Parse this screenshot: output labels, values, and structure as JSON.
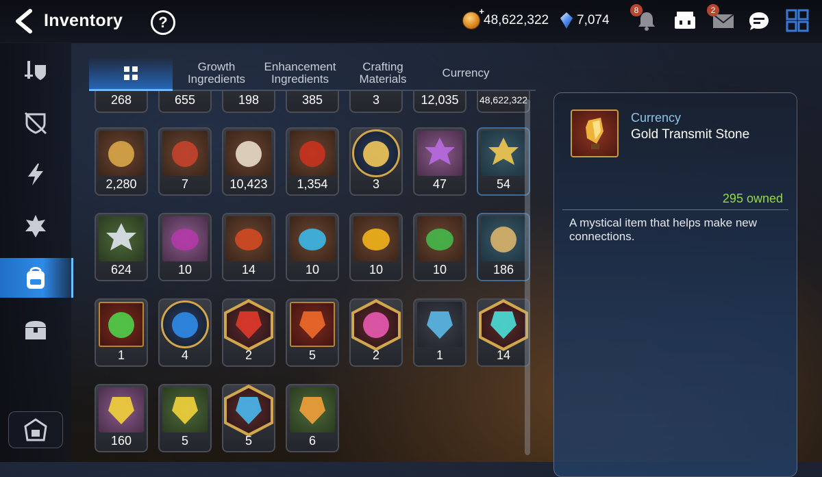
{
  "header": {
    "title": "Inventory",
    "help_label": "?",
    "gold": "48,622,322",
    "crystals": "7,074",
    "notifications_badge": "8",
    "mail_badge": "2"
  },
  "icons": {
    "back": "chevron-left-icon",
    "help": "question-circle-icon",
    "gold": "gold-coin-icon",
    "crystal": "crystal-gem-icon",
    "bell": "bell-icon",
    "shop": "shop-icon",
    "mail": "mail-icon",
    "chat": "chat-icon",
    "menu": "grid-menu-icon"
  },
  "sidebar": {
    "items": [
      {
        "name": "equipment-icon"
      },
      {
        "name": "artifact-icon"
      },
      {
        "name": "lightning-icon"
      },
      {
        "name": "rune-icon"
      },
      {
        "name": "backpack-icon",
        "active": true
      },
      {
        "name": "chest-icon"
      }
    ],
    "bottom": "guild-icon"
  },
  "tabs": [
    {
      "label": "",
      "icon": "grid-icon",
      "active": true
    },
    {
      "label": "Growth\nIngredients"
    },
    {
      "label": "Enhancement\nIngredients"
    },
    {
      "label": "Crafting\nMaterials"
    },
    {
      "label": "Currency"
    }
  ],
  "top_row_counts": [
    "268",
    "655",
    "198",
    "385",
    "3",
    "12,035",
    "48,622,322"
  ],
  "rows": [
    [
      {
        "qty": "2,280",
        "art": "brown",
        "icon": "fist-emblem"
      },
      {
        "qty": "7",
        "art": "brown",
        "icon": "banner-emblem"
      },
      {
        "qty": "10,423",
        "art": "brown",
        "icon": "knight-emblem"
      },
      {
        "qty": "1,354",
        "art": "brown",
        "icon": "leaf-emblem"
      },
      {
        "qty": "3",
        "art": "circle",
        "icon": "creature-portrait"
      },
      {
        "qty": "47",
        "art": "purple",
        "icon": "purple-flower"
      },
      {
        "qty": "54",
        "art": "teal",
        "icon": "gold-flower",
        "blue": true
      }
    ],
    [
      {
        "qty": "624",
        "art": "green",
        "icon": "white-flower"
      },
      {
        "qty": "10",
        "art": "purple",
        "icon": "purple-rune"
      },
      {
        "qty": "14",
        "art": "brown",
        "icon": "red-rune"
      },
      {
        "qty": "10",
        "art": "brown",
        "icon": "blue-rune"
      },
      {
        "qty": "10",
        "art": "brown",
        "icon": "yellow-rune"
      },
      {
        "qty": "10",
        "art": "brown",
        "icon": "green-rune"
      },
      {
        "qty": "186",
        "art": "teal",
        "icon": "fish-charm",
        "blue": true
      }
    ],
    [
      {
        "qty": "1",
        "art": "red",
        "icon": "green-orb"
      },
      {
        "qty": "4",
        "art": "circle",
        "icon": "blue-circuit"
      },
      {
        "qty": "2",
        "art": "hex",
        "icon": "red-stone"
      },
      {
        "qty": "5",
        "art": "red",
        "icon": "orange-hammer-stone"
      },
      {
        "qty": "2",
        "art": "hex",
        "icon": "pink-potion"
      },
      {
        "qty": "1",
        "art": "dark",
        "icon": "blue-hammer-stone"
      },
      {
        "qty": "14",
        "art": "hex",
        "icon": "teal-cross-stone"
      }
    ],
    [
      {
        "qty": "160",
        "art": "purple",
        "icon": "yellow-hammer-stone"
      },
      {
        "qty": "5",
        "art": "green",
        "icon": "yellow-bolt-stone"
      },
      {
        "qty": "5",
        "art": "hex",
        "icon": "blue-cross-stone"
      },
      {
        "qty": "6",
        "art": "green",
        "icon": "gold-transmit-stone"
      }
    ]
  ],
  "detail": {
    "category": "Currency",
    "name": "Gold Transmit Stone",
    "owned": "295 owned",
    "description": "A mystical item that helps make new connections.",
    "icon": "gold-transmit-stone-icon"
  }
}
